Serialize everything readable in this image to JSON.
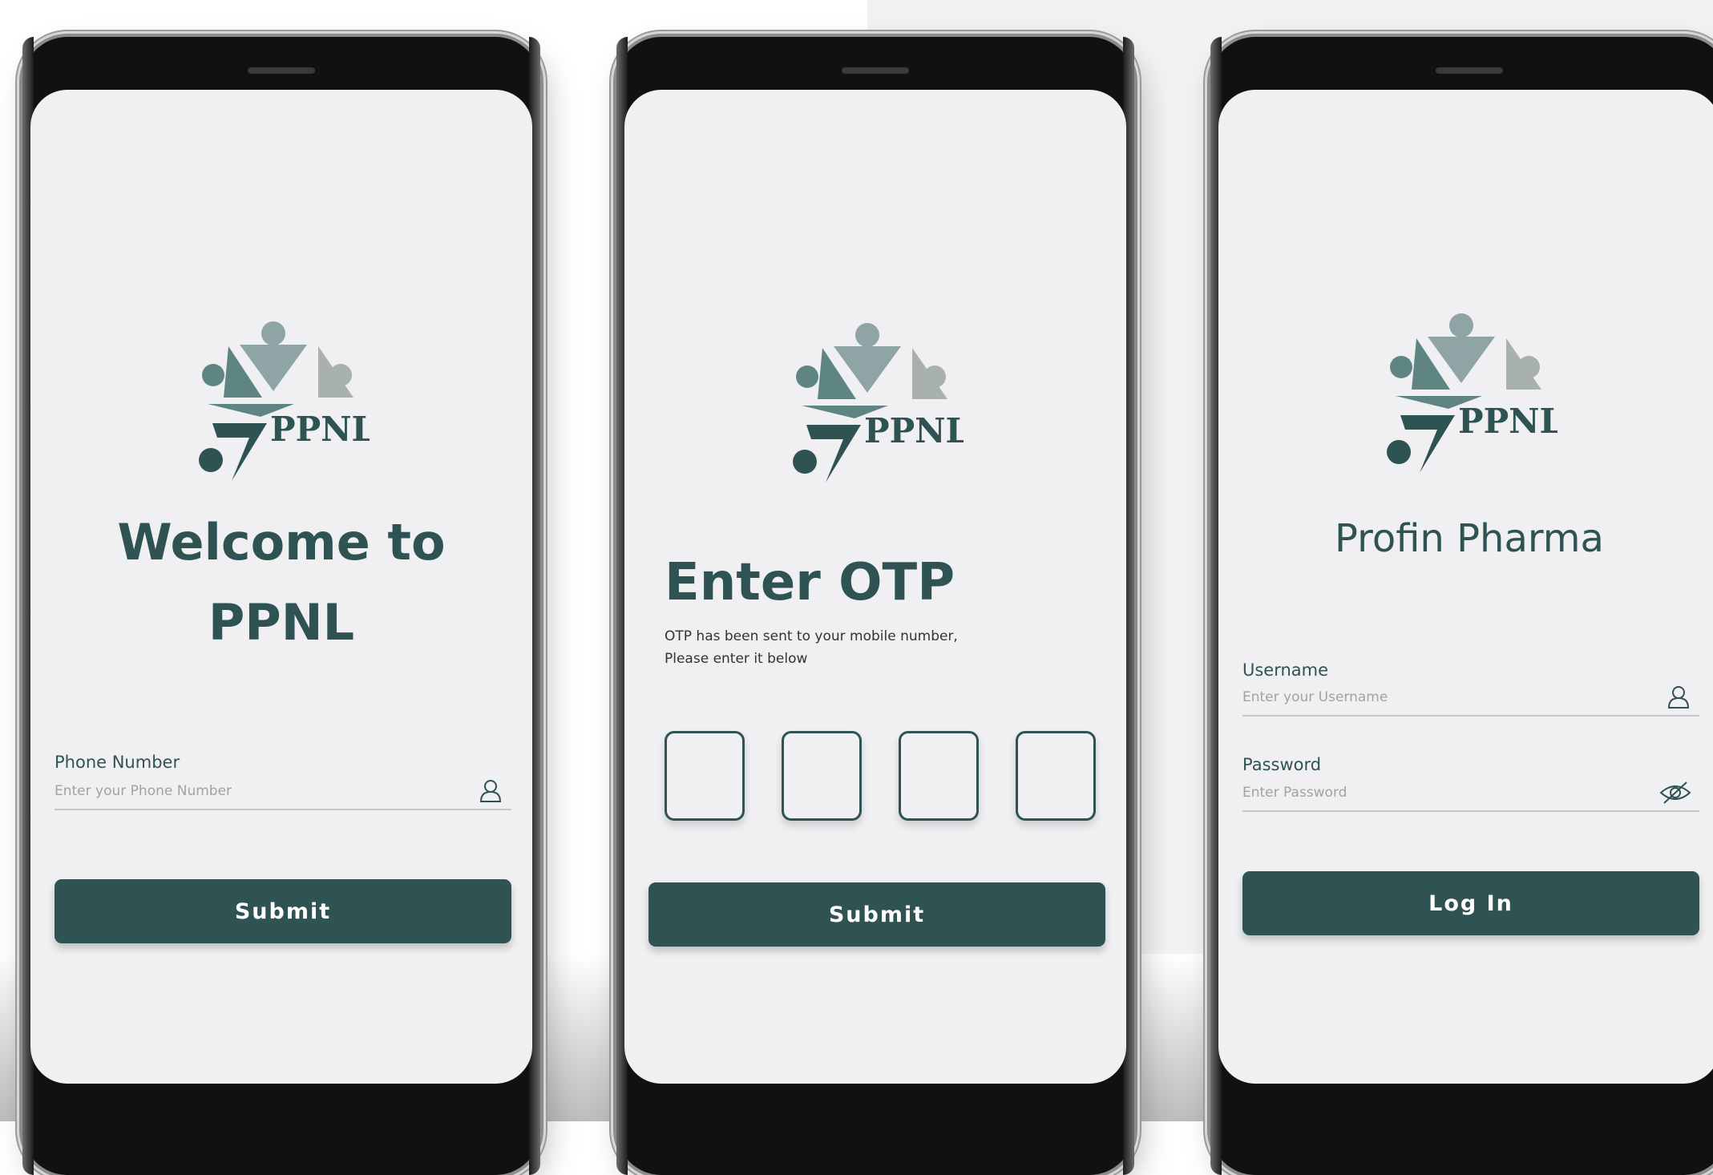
{
  "brand": {
    "logo_text": "PPNL",
    "primary_color": "#2f5352",
    "logo_colors": [
      "#2f5352",
      "#5e8582",
      "#8fa5a5",
      "#a9b1ad"
    ]
  },
  "screen_welcome": {
    "title_line1": "Welcome to",
    "title_line2": "PPNL",
    "phone_label": "Phone Number",
    "phone_placeholder": "Enter your Phone Number",
    "submit_label": "Submit"
  },
  "screen_otp": {
    "title": "Enter OTP",
    "subtitle_line1": "OTP has been sent to your mobile number,",
    "subtitle_line2": "Please enter it below",
    "otp_values": [
      "",
      "",
      "",
      ""
    ],
    "submit_label": "Submit"
  },
  "screen_login": {
    "title": "Profin Pharma",
    "username_label": "Username",
    "username_placeholder": "Enter your Username",
    "password_label": "Password",
    "password_placeholder": "Enter Password",
    "login_label": "Log In"
  }
}
